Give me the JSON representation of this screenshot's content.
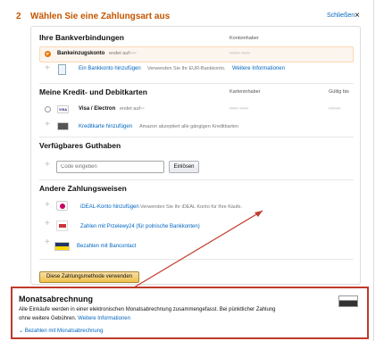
{
  "step": {
    "number": "2",
    "title": "Wählen Sie eine Zahlungsart aus",
    "close_label": "Schließen",
    "close_icon": "×"
  },
  "bank": {
    "title": "Ihre Bankverbindungen",
    "col_holder": "Kontoinhaber",
    "selected_label": "Bankeinzugskonto",
    "selected_suffix": "endet auf",
    "add_link": "Ein Bankkonto hinzufügen",
    "add_hint": "Verwenden Sie Ihr EUR-Bankkonto.",
    "add_more": "Weitere Informationen"
  },
  "cards": {
    "title": "Meine Kredit- und Debitkarten",
    "col_holder": "Karteninhaber",
    "col_valid": "Gültig bis",
    "card_label": "Visa / Electron",
    "card_suffix": "endet auf",
    "add_link": "Kreditkarte hinzufügen",
    "add_hint": "Amazon akzeptiert alle gängigen Kreditkarten"
  },
  "credit": {
    "title": "Verfügbares Guthaben",
    "placeholder": "Code eingeben",
    "apply_label": "Einlösen"
  },
  "other": {
    "title": "Andere Zahlungsweisen",
    "ideal_link": "iDEAL-Konto hinzufügen",
    "ideal_hint": "Verwenden Sie Ihr iDEAL Konto für Ihre Käufe.",
    "p24_link": "Zahlen mit Przelewy24 (für polnische Bankkonten)",
    "bancontact_link": "Bezahlen mit Bancontact"
  },
  "use_button": "Diese Zahlungsmethode verwenden",
  "monthly": {
    "title": "Monatsabrechnung",
    "text": "Alle Einkäufe werden in einer elektronischen Monatsabrechnung zusammengefasst. Bei pünktlicher Zahlung ohne weitere Gebühren.",
    "more": "Weitere Informationen",
    "pay_link": "Bezahlen mit Monatsabrechnung",
    "chevron": "⌄"
  },
  "colors": {
    "accent": "#c45500",
    "link": "#0066c0",
    "highlight": "#c0392b",
    "button": "#f0c14b"
  }
}
